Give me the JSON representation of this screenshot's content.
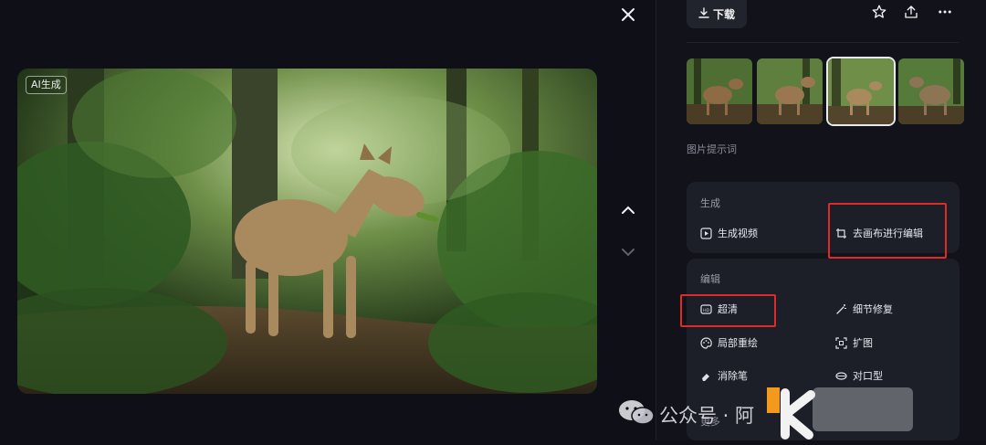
{
  "viewer": {
    "badge": "AI生成"
  },
  "toolbar": {
    "download_label": "下载"
  },
  "panel": {
    "prompt_label": "图片提示词",
    "generate": {
      "title": "生成",
      "actions": [
        {
          "label": "生成视频",
          "icon": "video-play-icon"
        },
        {
          "label": "去画布进行编辑",
          "icon": "canvas-crop-icon"
        }
      ]
    },
    "edit": {
      "title": "编辑",
      "actions": [
        {
          "label": "超清",
          "icon": "hd-icon"
        },
        {
          "label": "细节修复",
          "icon": "magic-wand-icon"
        },
        {
          "label": "局部重绘",
          "icon": "palette-icon"
        },
        {
          "label": "扩图",
          "icon": "expand-icon"
        },
        {
          "label": "消除笔",
          "icon": "eraser-icon"
        },
        {
          "label": "对口型",
          "icon": "lip-sync-icon"
        }
      ],
      "more": "更多"
    }
  },
  "watermark": {
    "text": "公众号 · 阿"
  },
  "colors": {
    "background": "#0f1017",
    "card": "#1d1f28",
    "highlight_box": "#e02a2a"
  }
}
